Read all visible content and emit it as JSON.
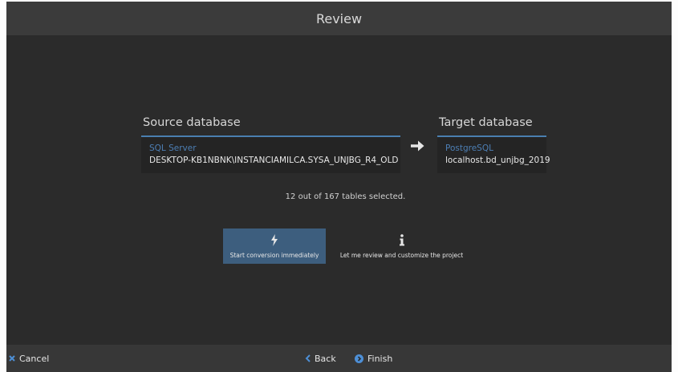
{
  "window": {
    "title": "Review"
  },
  "source": {
    "heading": "Source database",
    "engine": "SQL Server",
    "connection": "DESKTOP-KB1NBNK\\INSTANCIAMILCA.SYSA_UNJBG_R4_OLD"
  },
  "target": {
    "heading": "Target database",
    "engine": "PostgreSQL",
    "connection": "localhost.bd_unjbg_2019"
  },
  "tables_info": "12 out of 167 tables selected.",
  "options": {
    "start": {
      "label": "Start conversion immediately",
      "icon": "lightning-icon",
      "selected": true
    },
    "review": {
      "label": "Let me review and customize the project",
      "icon": "info-icon",
      "selected": false
    }
  },
  "footer": {
    "cancel_label": "Cancel",
    "back_label": "Back",
    "finish_label": "Finish"
  },
  "colors": {
    "background": "#2b2b2b",
    "title_bar": "#3b3b3b",
    "accent": "#4a7fb0",
    "selected_option": "#3d5e7e",
    "footer": "#373737"
  }
}
